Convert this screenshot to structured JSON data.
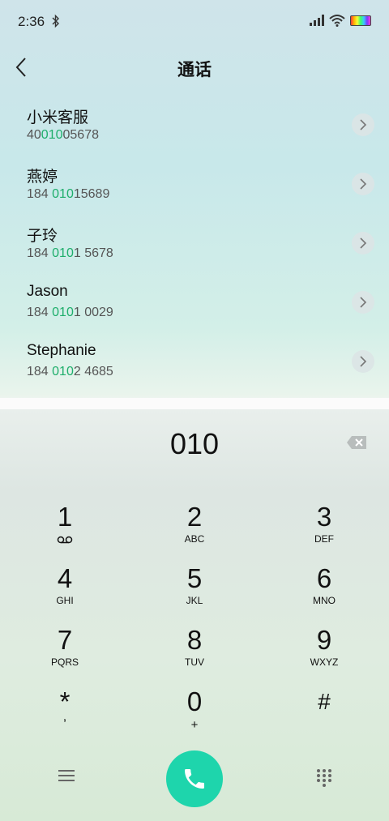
{
  "status_bar": {
    "time": "2:36"
  },
  "header": {
    "title": "通话"
  },
  "contacts": [
    {
      "name": "小米客服",
      "num_pre": "40",
      "num_hl": "010",
      "num_post": "05678"
    },
    {
      "name": "燕婷",
      "num_pre": "184 ",
      "num_hl": "010",
      "num_post": "15689"
    },
    {
      "name": "子玲",
      "num_pre": "184 ",
      "num_hl": "010",
      "num_post": "1 5678"
    },
    {
      "name": "Jason",
      "num_pre": "184 ",
      "num_hl": "010",
      "num_post": "1 0029"
    },
    {
      "name": "Stephanie",
      "num_pre": "184 ",
      "num_hl": "010",
      "num_post": "2 4685"
    }
  ],
  "dialer": {
    "number": "010",
    "keys": [
      {
        "digit": "1",
        "letters": ""
      },
      {
        "digit": "2",
        "letters": "ABC"
      },
      {
        "digit": "3",
        "letters": "DEF"
      },
      {
        "digit": "4",
        "letters": "GHI"
      },
      {
        "digit": "5",
        "letters": "JKL"
      },
      {
        "digit": "6",
        "letters": "MNO"
      },
      {
        "digit": "7",
        "letters": "PQRS"
      },
      {
        "digit": "8",
        "letters": "TUV"
      },
      {
        "digit": "9",
        "letters": "WXYZ"
      },
      {
        "digit": "*",
        "letters": ","
      },
      {
        "digit": "0",
        "letters": "+"
      },
      {
        "digit": "#",
        "letters": ""
      }
    ]
  },
  "colors": {
    "accent": "#1ed5ac",
    "highlight": "#1eae6b"
  },
  "icons": {
    "back": "chevron-left-icon",
    "detail": "chevron-right-icon",
    "backspace": "backspace-icon",
    "voicemail": "voicemail-icon",
    "menu": "menu-icon",
    "call": "phone-icon",
    "keypad": "dialpad-icon"
  }
}
